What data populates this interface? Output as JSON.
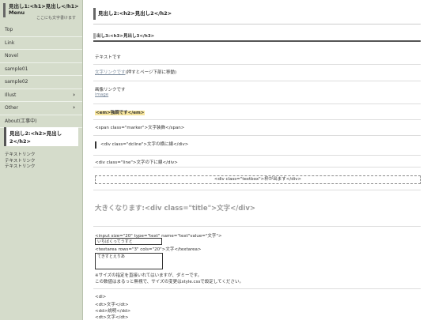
{
  "sidebar": {
    "site_title": "見出し1:<h1>見出し</h1> Menu",
    "tagline": "ここにも文字書けます",
    "menu": [
      {
        "label": "Top",
        "arrow": ""
      },
      {
        "label": "Link",
        "arrow": ""
      },
      {
        "label": "Novel",
        "arrow": ""
      },
      {
        "label": "sample01",
        "arrow": ""
      },
      {
        "label": "sample02",
        "arrow": ""
      },
      {
        "label": "Illust",
        "arrow": "›"
      },
      {
        "label": "Other",
        "arrow": "›"
      },
      {
        "label": "About(工事中)",
        "arrow": ""
      }
    ],
    "box_heading": "見出し2:<h2>見出し2</h2>",
    "links": [
      "テキストリンク",
      "テキストリンク",
      "テキストリンク"
    ]
  },
  "main": {
    "h2": "見出し2:<h2>見出し2</h2>",
    "h3": "出し3:<h3>見出し3</h3>",
    "text1": "テキストです",
    "link_text": "文字リンクです",
    "link_note": "(押すとページ下部に移動)",
    "image_label": "画像リンクです",
    "image_alt": "image",
    "em_text": "<em>強調です</em>",
    "marker_text": "<span class=\"marker\">文字装飾</span>",
    "dcline_text": "<div class=\"dcline\">文字の横に線</div>",
    "line_text": "<div class=\"line\">文字の下に線</div>",
    "textbox_text": "<div class=\"textbox\">枠が出ます</div>",
    "big_title": "大きくなります:<div class=\"title\">文字</div>",
    "input_code": "<input size=\"20\" type=\"text\" name=\"text\"value=\"文字\">",
    "input_value": "いちばくってうすと",
    "textarea_code": "<textarea rows=\"3\" cols=\"20\">文字</textarea>",
    "textarea_value": "てきすとえりあ",
    "note1": "※サイズの指定を直接いれてはいますが、ダミーです。",
    "note2": "この数値はまるっと無視で、サイズの変更はstyle.cssで設定してください。",
    "dl_lines": [
      "<dl>",
      "<dt>文字</dt>",
      "<dd>説明</dd>",
      "<dt>文字</dt>"
    ]
  }
}
